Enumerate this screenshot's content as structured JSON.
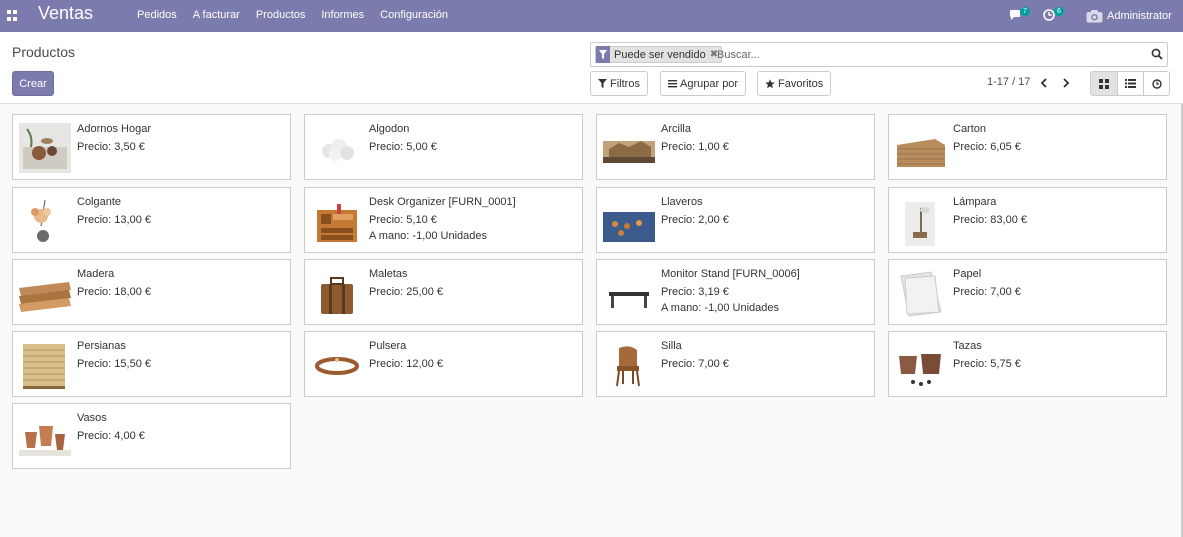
{
  "navbar": {
    "brand": "Ventas",
    "menu": [
      "Pedidos",
      "A facturar",
      "Productos",
      "Informes",
      "Configuración"
    ],
    "messages_count": "7",
    "activities_count": "6",
    "user": "Administrator",
    "bg_color": "#7c7bad"
  },
  "control": {
    "title": "Productos",
    "create_label": "Crear",
    "facet_label": "Puede ser vendido",
    "search_placeholder": "Buscar...",
    "filters_label": "Filtros",
    "group_label": "Agrupar por",
    "favorites_label": "Favoritos",
    "pager": "1-17 / 17"
  },
  "products": [
    {
      "name": "Adornos Hogar",
      "price": "Precio: 3,50 €",
      "stock": "",
      "icon": "decor-image"
    },
    {
      "name": "Algodon",
      "price": "Precio: 5,00 €",
      "stock": "",
      "icon": "cotton-image"
    },
    {
      "name": "Arcilla",
      "price": "Precio: 1,00 €",
      "stock": "",
      "icon": "clay-image"
    },
    {
      "name": "Carton",
      "price": "Precio: 6,05 €",
      "stock": "",
      "icon": "cardboard-image"
    },
    {
      "name": "Colgante",
      "price": "Precio: 13,00 €",
      "stock": "",
      "icon": "pendant-image"
    },
    {
      "name": "Desk Organizer [FURN_0001]",
      "price": "Precio: 5,10 €",
      "stock": "A mano: -1,00 Unidades",
      "icon": "desk-organizer-image"
    },
    {
      "name": "Llaveros",
      "price": "Precio: 2,00 €",
      "stock": "",
      "icon": "keychain-image"
    },
    {
      "name": "Lámpara",
      "price": "Precio: 83,00 €",
      "stock": "",
      "icon": "lamp-image"
    },
    {
      "name": "Madera",
      "price": "Precio: 18,00 €",
      "stock": "",
      "icon": "wood-image"
    },
    {
      "name": "Maletas",
      "price": "Precio: 25,00 €",
      "stock": "",
      "icon": "suitcase-image"
    },
    {
      "name": "Monitor Stand [FURN_0006]",
      "price": "Precio: 3,19 €",
      "stock": "A mano: -1,00 Unidades",
      "icon": "monitor-stand-image"
    },
    {
      "name": "Papel",
      "price": "Precio: 7,00 €",
      "stock": "",
      "icon": "paper-image"
    },
    {
      "name": "Persianas",
      "price": "Precio: 15,50 €",
      "stock": "",
      "icon": "blinds-image"
    },
    {
      "name": "Pulsera",
      "price": "Precio: 12,00 €",
      "stock": "",
      "icon": "bracelet-image"
    },
    {
      "name": "Silla",
      "price": "Precio: 7,00 €",
      "stock": "",
      "icon": "chair-image"
    },
    {
      "name": "Tazas",
      "price": "Precio: 5,75 €",
      "stock": "",
      "icon": "cups-image"
    },
    {
      "name": "Vasos",
      "price": "Precio: 4,00 €",
      "stock": "",
      "icon": "pots-image"
    }
  ]
}
